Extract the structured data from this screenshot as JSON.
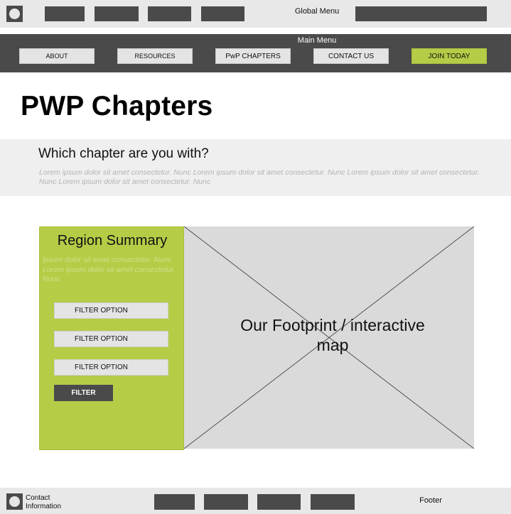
{
  "global_bar": {
    "label": "Global Menu",
    "logo_icon": "logo-placeholder-icon",
    "nav_items": [
      "",
      "",
      "",
      ""
    ]
  },
  "main_menu": {
    "label": "Main Menu",
    "items": [
      {
        "label": "ABOUT"
      },
      {
        "label": "RESOURCES"
      },
      {
        "label": "PwP CHAPTERS"
      },
      {
        "label": "CONTACT US"
      },
      {
        "label": "JOIN TODAY"
      }
    ],
    "join_color": "#b5cc47"
  },
  "page": {
    "title": "PWP Chapters"
  },
  "intro": {
    "heading": "Which chapter are you with?",
    "text": "Lorem ipsum dolor sit amet consectetur. Nunc  Lorem ipsum dolor sit amet consectetur. Nunc  Lorem ipsum dolor sit amet consectetur. Nunc   Lorem ipsum dolor sit amet consectetur. Nunc"
  },
  "region": {
    "title": "Region Summary",
    "text": "ipsum dolor sit amet consectetur. Nunc  Lorem ipsum dolor sit amet consectetur. Nunc",
    "filters": [
      {
        "label": "FILTER OPTION"
      },
      {
        "label": "FILTER OPTION"
      },
      {
        "label": "FILTER OPTION"
      }
    ],
    "filter_button": "FILTER",
    "panel_color": "#b5cc47"
  },
  "map": {
    "label": "Our Footprint / interactive map"
  },
  "footer": {
    "contact": "Contact Information",
    "label": "Footer",
    "nav_items": [
      "",
      "",
      "",
      ""
    ]
  },
  "colors": {
    "dark": "#4a4a4a",
    "accent": "#b5cc47",
    "light_gray": "#e8e8e8"
  }
}
